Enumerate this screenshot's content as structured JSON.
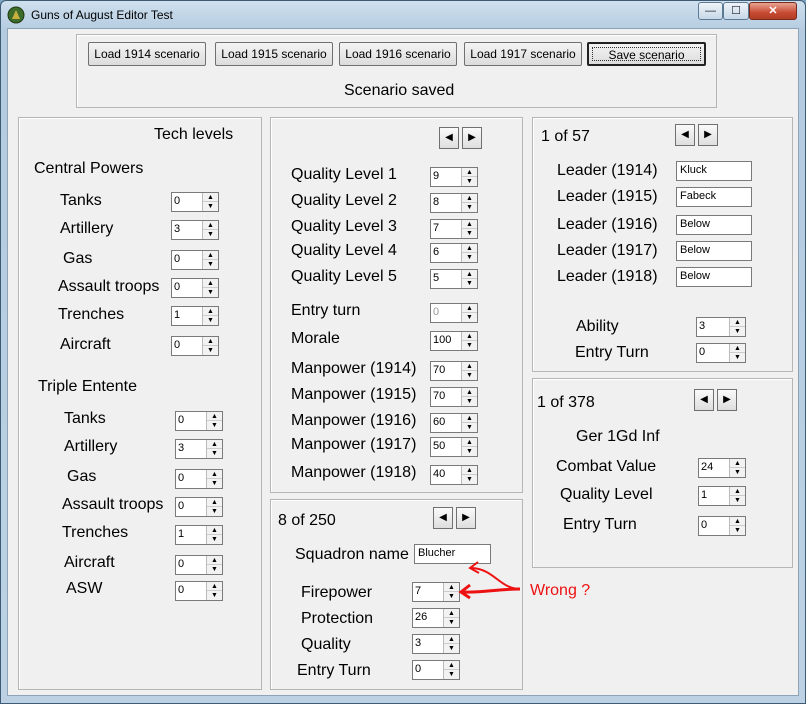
{
  "window": {
    "title": "Guns of August Editor Test",
    "min_glyph": "—",
    "max_glyph": "☐",
    "close_glyph": "✕"
  },
  "top": {
    "buttons": [
      "Load 1914 scenario",
      "Load 1915 scenario",
      "Load 1916 scenario",
      "Load 1917 scenario",
      "Save scenario"
    ],
    "status": "Scenario saved"
  },
  "tech": {
    "title": "Tech levels",
    "central": {
      "label": "Central Powers",
      "rows": [
        {
          "label": "Tanks",
          "value": "0"
        },
        {
          "label": "Artillery",
          "value": "3"
        },
        {
          "label": "Gas",
          "value": "0"
        },
        {
          "label": "Assault troops",
          "value": "0"
        },
        {
          "label": "Trenches",
          "value": "1"
        },
        {
          "label": "Aircraft",
          "value": "0"
        }
      ]
    },
    "entente": {
      "label": "Triple Entente",
      "rows": [
        {
          "label": "Tanks",
          "value": "0"
        },
        {
          "label": "Artillery",
          "value": "3"
        },
        {
          "label": "Gas",
          "value": "0"
        },
        {
          "label": "Assault troops",
          "value": "0"
        },
        {
          "label": "Trenches",
          "value": "1"
        },
        {
          "label": "Aircraft",
          "value": "0"
        },
        {
          "label": "ASW",
          "value": "0"
        }
      ]
    }
  },
  "nation": {
    "rows": [
      {
        "label": "Quality Level 1",
        "value": "9"
      },
      {
        "label": "Quality Level 2",
        "value": "8"
      },
      {
        "label": "Quality Level 3",
        "value": "7"
      },
      {
        "label": "Quality Level 4",
        "value": "6"
      },
      {
        "label": "Quality Level 5",
        "value": "5"
      },
      {
        "label": "Entry turn",
        "value": "0"
      },
      {
        "label": "Morale",
        "value": "100"
      },
      {
        "label": "Manpower (1914)",
        "value": "70"
      },
      {
        "label": "Manpower (1915)",
        "value": "70"
      },
      {
        "label": "Manpower (1916)",
        "value": "60"
      },
      {
        "label": "Manpower (1917)",
        "value": "50"
      },
      {
        "label": "Manpower (1918)",
        "value": "40"
      }
    ]
  },
  "squadron": {
    "counter": "8 of 250",
    "name_label": "Squadron name",
    "name_value": "Blucher",
    "rows": [
      {
        "label": "Firepower",
        "value": "7"
      },
      {
        "label": "Protection",
        "value": "26"
      },
      {
        "label": "Quality",
        "value": "3"
      },
      {
        "label": "Entry Turn",
        "value": "0"
      }
    ]
  },
  "leader": {
    "counter": "1 of 57",
    "rows": [
      {
        "label": "Leader (1914)",
        "value": "Kluck"
      },
      {
        "label": "Leader (1915)",
        "value": "Fabeck"
      },
      {
        "label": "Leader (1916)",
        "value": "Below"
      },
      {
        "label": "Leader (1917)",
        "value": "Below"
      },
      {
        "label": "Leader (1918)",
        "value": "Below"
      }
    ],
    "ability_label": "Ability",
    "ability_value": "3",
    "entry_label": "Entry Turn",
    "entry_value": "0"
  },
  "unit": {
    "counter": "1 of 378",
    "name": "Ger 1Gd Inf",
    "rows": [
      {
        "label": "Combat Value",
        "value": "24"
      },
      {
        "label": "Quality Level",
        "value": "1"
      },
      {
        "label": "Entry Turn",
        "value": "0"
      }
    ]
  },
  "annotation": {
    "text": "Wrong ?",
    "color": "#e11111"
  },
  "icons": {
    "nav_left": "◀",
    "nav_right": "▶",
    "spin_up": "▲",
    "spin_down": "▼"
  }
}
